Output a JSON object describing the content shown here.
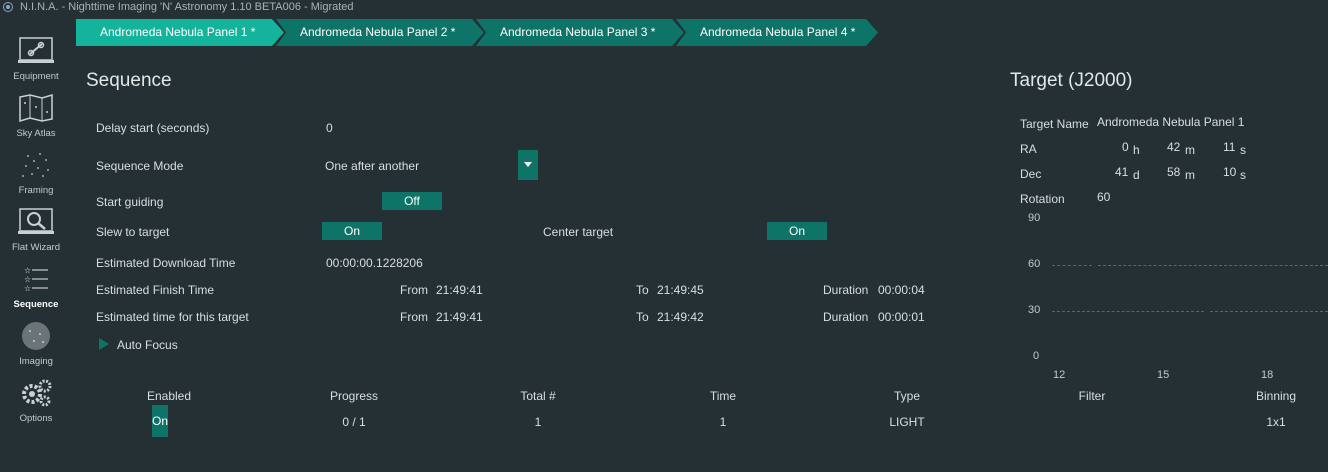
{
  "window": {
    "title": "N.I.N.A. - Nighttime Imaging 'N' Astronomy 1.10 BETA006  -  Migrated"
  },
  "sidebar": {
    "items": [
      {
        "label": "Equipment",
        "icon": "equipment-icon"
      },
      {
        "label": "Sky Atlas",
        "icon": "sky-atlas-icon"
      },
      {
        "label": "Framing",
        "icon": "framing-icon"
      },
      {
        "label": "Flat Wizard",
        "icon": "flat-wizard-icon"
      },
      {
        "label": "Sequence",
        "icon": "sequence-icon",
        "active": true
      },
      {
        "label": "Imaging",
        "icon": "imaging-icon"
      },
      {
        "label": "Options",
        "icon": "options-icon"
      }
    ]
  },
  "tabs": [
    {
      "label": "Andromeda Nebula Panel 1 *",
      "active": true
    },
    {
      "label": "Andromeda Nebula Panel 2 *"
    },
    {
      "label": "Andromeda Nebula Panel 3 *"
    },
    {
      "label": "Andromeda Nebula Panel 4 *"
    }
  ],
  "sequence": {
    "title": "Sequence",
    "delay_label": "Delay start (seconds)",
    "delay_value": "0",
    "mode_label": "Sequence Mode",
    "mode_value": "One after another",
    "guiding_label": "Start guiding",
    "guiding_value": "Off",
    "slew_label": "Slew to target",
    "slew_value": "On",
    "center_label": "Center target",
    "center_value": "On",
    "download_label": "Estimated Download Time",
    "download_value": "00:00:00.1228206",
    "finish_label": "Estimated Finish Time",
    "finish_from_label": "From",
    "finish_from": "21:49:41",
    "finish_to_label": "To",
    "finish_to": "21:49:45",
    "finish_duration_label": "Duration",
    "finish_duration": "00:00:04",
    "target_time_label": "Estimated time for this target",
    "target_from_label": "From",
    "target_from": "21:49:41",
    "target_to_label": "To",
    "target_to": "21:49:42",
    "target_duration_label": "Duration",
    "target_duration": "00:00:01",
    "autofocus_label": "Auto Focus"
  },
  "table": {
    "headers": {
      "enabled": "Enabled",
      "progress": "Progress",
      "total": "Total #",
      "time": "Time",
      "type": "Type",
      "filter": "Filter",
      "binning": "Binning"
    },
    "rows": [
      {
        "enabled": "On",
        "progress": "0 / 1",
        "total": "1",
        "time": "1",
        "type": "LIGHT",
        "filter": "",
        "binning": "1x1"
      }
    ]
  },
  "target": {
    "title": "Target (J2000)",
    "name_label": "Target Name",
    "name_value": "Andromeda Nebula Panel 1",
    "ra_label": "RA",
    "ra_h": "0",
    "ra_h_unit": "h",
    "ra_m": "42",
    "ra_m_unit": "m",
    "ra_s": "11",
    "ra_s_unit": "s",
    "dec_label": "Dec",
    "dec_d": "41",
    "dec_d_unit": "d",
    "dec_m": "58",
    "dec_m_unit": "m",
    "dec_s": "10",
    "dec_s_unit": "s",
    "rotation_label": "Rotation",
    "rotation_value": "60"
  },
  "altitude_chart": {
    "y_ticks": [
      "90",
      "60",
      "30",
      "0"
    ],
    "x_ticks": [
      "12",
      "15",
      "18"
    ]
  },
  "colors": {
    "background": "#243033",
    "accent": "#0e7468",
    "tab_active": "#14b39c",
    "tab_inactive": "#0e7468"
  }
}
